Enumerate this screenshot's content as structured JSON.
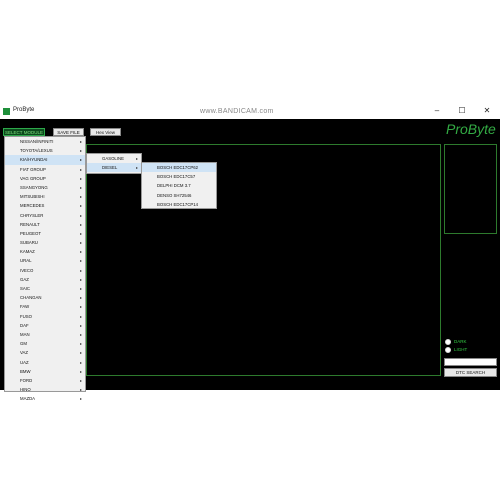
{
  "window": {
    "title": "ProByte",
    "watermark": "www.BANDICAM.com",
    "minimize_glyph": "–",
    "maximize_glyph": "☐",
    "close_glyph": "✕"
  },
  "toolbar": {
    "select_module_label": "SELECT MODULE",
    "save_file_label": "SAVE FILE",
    "hex_view_label": "Hex View"
  },
  "brand": "ProByte",
  "manufacturers": [
    "NISSAN/INFINITI",
    "TOYOTA/LEXUS",
    "KIA/HYUNDAI",
    "FIAT GROUP",
    "VAG GROUP",
    "SSANGYONG",
    "MITSUBISHI",
    "MERCEDES",
    "CHRYSLER",
    "RENAULT",
    "PEUGEOT",
    "SUBARU",
    "KAMAZ",
    "URAL",
    "IVECO",
    "GAZ",
    "SAIC",
    "CHANGAN",
    "FAW",
    "FUSO",
    "DAF",
    "MAN",
    "GM",
    "VAZ",
    "UAZ",
    "BMW",
    "FORD",
    "HINO",
    "MAZDA"
  ],
  "fuel_menu": [
    "GASOLINE",
    "DIESEL"
  ],
  "ecu_menu": [
    "BOSCH EDC17CP62",
    "BOSCH EDC17C57",
    "DELPHI DCM 3.7",
    "DENSO SH72546",
    "BOSCH EDC17CP14"
  ],
  "theme": {
    "dark_label": "DARK",
    "light_label": "LIGHT"
  },
  "dtc": {
    "search_label": "DTC SEARCH",
    "input_value": ""
  },
  "colors": {
    "accent_green": "#33aa44",
    "selected_row": "#cfe3f5",
    "background": "#000000"
  }
}
